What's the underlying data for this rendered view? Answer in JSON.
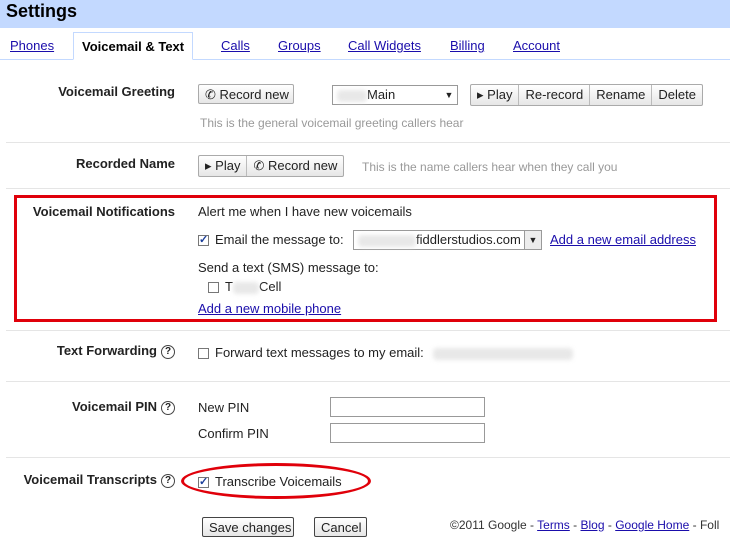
{
  "title": "Settings",
  "tabs": [
    {
      "label": "Phones"
    },
    {
      "label": "Voicemail & Text"
    },
    {
      "label": "Calls"
    },
    {
      "label": "Groups"
    },
    {
      "label": "Call Widgets"
    },
    {
      "label": "Billing"
    },
    {
      "label": "Account"
    }
  ],
  "greeting": {
    "label": "Voicemail Greeting",
    "record_new": "Record new",
    "selected": "Main",
    "play": "Play",
    "rerecord": "Re-record",
    "rename": "Rename",
    "delete": "Delete",
    "hint": "This is the general voicemail greeting callers hear"
  },
  "recorded_name": {
    "label": "Recorded Name",
    "play": "Play",
    "record_new": "Record new",
    "hint": "This is the name callers hear when they call you"
  },
  "notifications": {
    "label": "Voicemail Notifications",
    "alert": "Alert me when I have new voicemails",
    "email_label": "Email the message to:",
    "email_value": "fiddlerstudios.com",
    "add_email": "Add a new email address",
    "sms_label": "Send a text (SMS) message to:",
    "phone_prefix": "T",
    "phone_suffix": "Cell",
    "add_phone": "Add a new mobile phone"
  },
  "text_forwarding": {
    "label": "Text Forwarding",
    "help": "?",
    "checkbox_label": "Forward text messages to my email:"
  },
  "pin": {
    "label": "Voicemail PIN",
    "help": "?",
    "new_pin": "New PIN",
    "confirm_pin": "Confirm PIN"
  },
  "transcripts": {
    "label": "Voicemail Transcripts",
    "help": "?",
    "checkbox_label": "Transcribe Voicemails"
  },
  "actions": {
    "save": "Save changes",
    "cancel": "Cancel"
  },
  "footer": {
    "copyright": "©2011 Google -",
    "terms": "Terms",
    "dash1": "-",
    "blog": "Blog",
    "dash2": "-",
    "home": "Google Home",
    "dash3": "-",
    "trailing": "Foll"
  },
  "colors": {
    "header_bg": "#c3d9ff",
    "link": "#1a0dab",
    "highlight": "#e0000a"
  },
  "icons": {
    "phone": "phone-icon",
    "play": "play-icon",
    "dropdown": "dropdown-arrow-icon",
    "help": "help-icon"
  }
}
